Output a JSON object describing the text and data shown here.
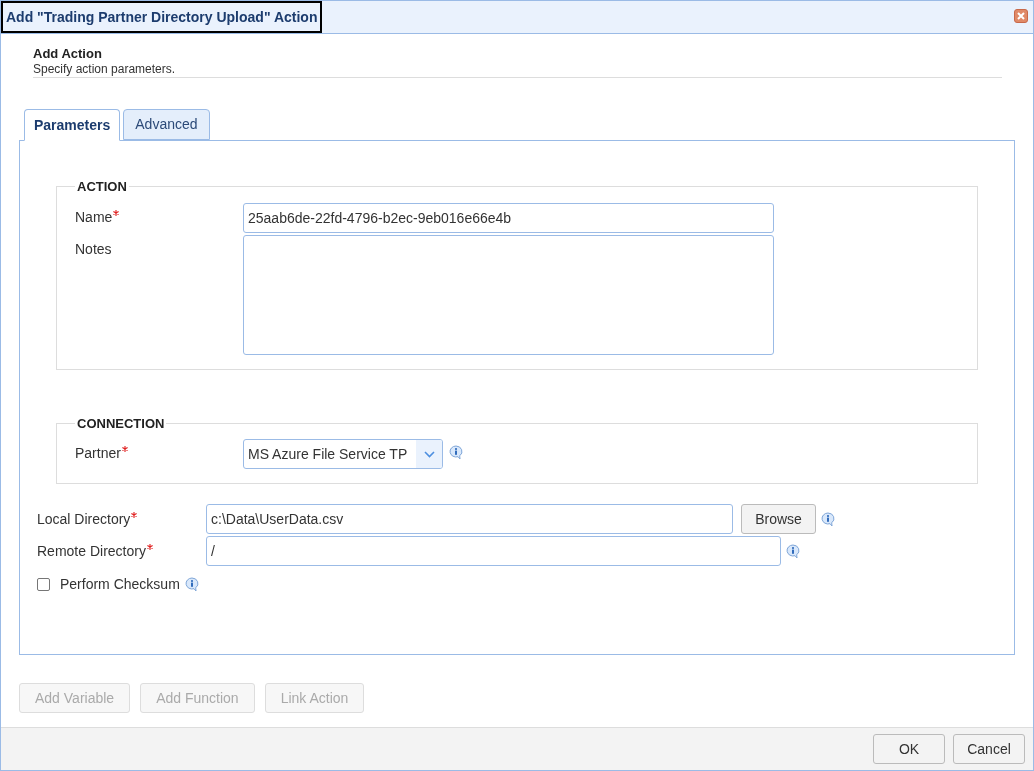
{
  "window": {
    "title": "Add \"Trading Partner Directory Upload\" Action"
  },
  "header": {
    "title": "Add Action",
    "subtitle": "Specify action parameters."
  },
  "tabs": [
    {
      "label": "Parameters",
      "selected": true
    },
    {
      "label": "Advanced",
      "selected": false
    }
  ],
  "sections": [
    {
      "title": "ACTION",
      "fields": [
        {
          "kind": "text",
          "label": "Name",
          "required": true,
          "value": "25aab6de-22fd-4796-b2ec-9eb016e66e4b"
        },
        {
          "kind": "textarea",
          "label": "Notes",
          "required": false
        }
      ]
    },
    {
      "title": "CONNECTION",
      "fields": [
        {
          "kind": "select",
          "label": "Partner",
          "required": true,
          "value": "MS Azure File Service TP"
        }
      ]
    }
  ],
  "local_directory": {
    "label": "Local Directory",
    "required": true,
    "value": "c:\\Data\\UserData.csv",
    "button": "Browse"
  },
  "remote_directory": {
    "label": "Remote Directory",
    "required": true,
    "value": "/"
  },
  "perform_checksum": {
    "label": "Perform Checksum",
    "checked": false
  },
  "action_buttons": [
    {
      "label": "Add Variable",
      "disabled": true
    },
    {
      "label": "Add Function",
      "disabled": true
    },
    {
      "label": "Link Action",
      "disabled": true
    }
  ],
  "footer_buttons": [
    "OK",
    "Cancel"
  ]
}
